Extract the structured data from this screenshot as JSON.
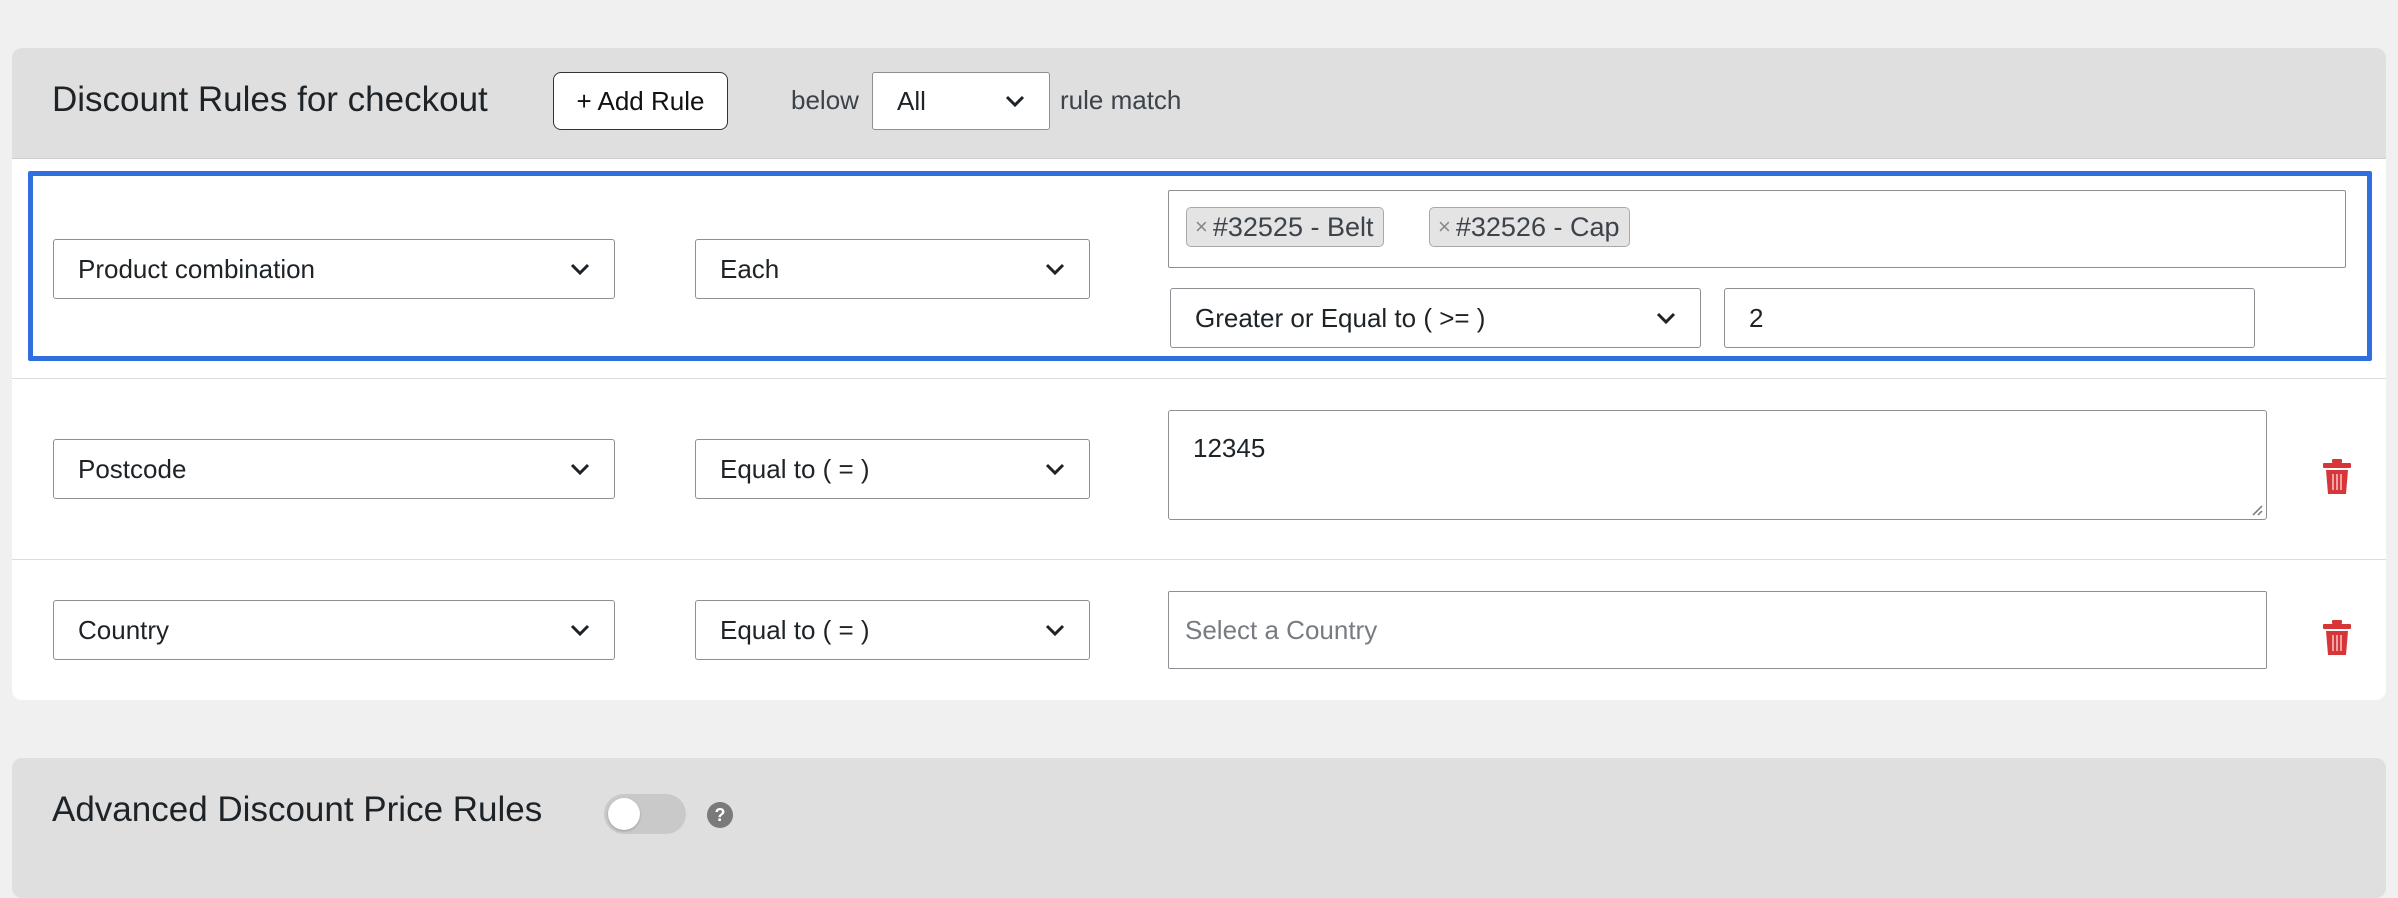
{
  "panel1": {
    "title": "Discount Rules for checkout",
    "add_rule_label": "+ Add Rule",
    "below_label": "below",
    "match_select": "All",
    "rule_match_label": "rule match"
  },
  "rules": [
    {
      "condition": "Product combination",
      "operator": "Each",
      "products": [
        "#32525 - Belt",
        "#32526 - Cap"
      ],
      "quantity_operator": "Greater or Equal to ( >= )",
      "quantity_value": "2"
    },
    {
      "condition": "Postcode",
      "operator": "Equal to ( = )",
      "value": "12345"
    },
    {
      "condition": "Country",
      "operator": "Equal to ( = )",
      "placeholder": "Select a Country"
    }
  ],
  "panel2": {
    "title": "Advanced Discount Price Rules",
    "toggle_state": "off",
    "help_glyph": "?"
  },
  "icons": {
    "tag_remove": "×",
    "dropdown": "chevron-down-icon",
    "delete": "trash-icon"
  },
  "colors": {
    "highlight": "#2f6fde",
    "delete": "#d63638"
  }
}
